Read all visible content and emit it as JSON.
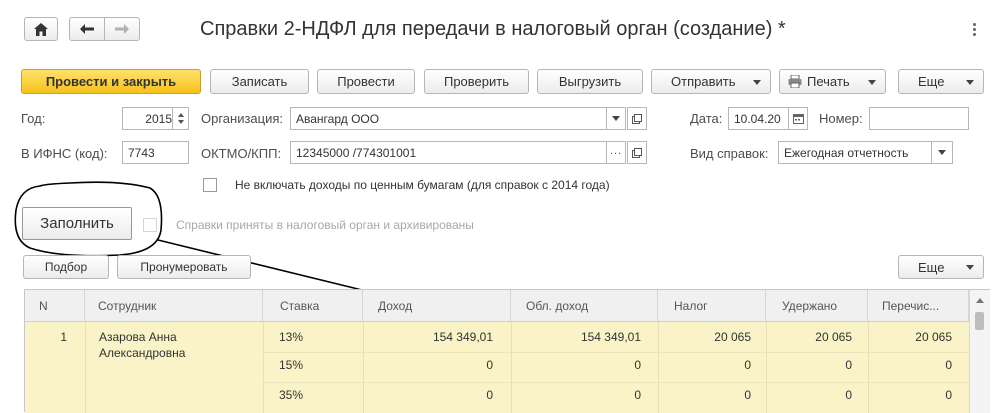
{
  "window": {
    "title": "Справки 2-НДФЛ для передачи в налоговый орган (создание) *",
    "more_icon": "vertical-dots-icon"
  },
  "toolbar": {
    "post_close": "Провести и закрыть",
    "save": "Записать",
    "post": "Провести",
    "check": "Проверить",
    "export": "Выгрузить",
    "send": "Отправить",
    "print": "Печать",
    "more": "Еще"
  },
  "form": {
    "year_label": "Год:",
    "year_value": "2015",
    "org_label": "Организация:",
    "org_value": "Авангард ООО",
    "date_label": "Дата:",
    "date_value": "10.04.20",
    "number_label": "Номер:",
    "number_value": "",
    "ifns_label": "В ИФНС (код):",
    "ifns_value": "7743",
    "oktmo_label": "ОКТМО/КПП:",
    "oktmo_value": "12345000   /774301001",
    "kind_label": "Вид справок:",
    "kind_value": "Ежегодная отчетность",
    "securities_checkbox_label": "Не включать доходы по ценным бумагам (для справок с 2014 года)",
    "fill_button": "Заполнить",
    "archived_checkbox_label": "Справки приняты в налоговый орган и архивированы"
  },
  "table_toolbar": {
    "select": "Подбор",
    "renumber": "Пронумеровать",
    "more": "Еще"
  },
  "table": {
    "columns": [
      "N",
      "Сотрудник",
      "Ставка",
      "Доход",
      "Обл. доход",
      "Налог",
      "Удержано",
      "Перечис..."
    ],
    "rows": [
      {
        "n": "1",
        "employee_line1": "Азарова Анна",
        "employee_line2": "Александровна",
        "rates": [
          {
            "rate": "13%",
            "income": "154 349,01",
            "taxable": "154 349,01",
            "tax": "20 065",
            "withheld": "20 065",
            "transferred": "20 065"
          },
          {
            "rate": "15%",
            "income": "0",
            "taxable": "0",
            "tax": "0",
            "withheld": "0",
            "transferred": "0"
          },
          {
            "rate": "35%",
            "income": "0",
            "taxable": "0",
            "tax": "0",
            "withheld": "0",
            "transferred": "0"
          }
        ]
      }
    ]
  },
  "colors": {
    "accent_yellow": "#f6c21a",
    "selected_row": "#faf3c8",
    "annotation": "#000000"
  }
}
